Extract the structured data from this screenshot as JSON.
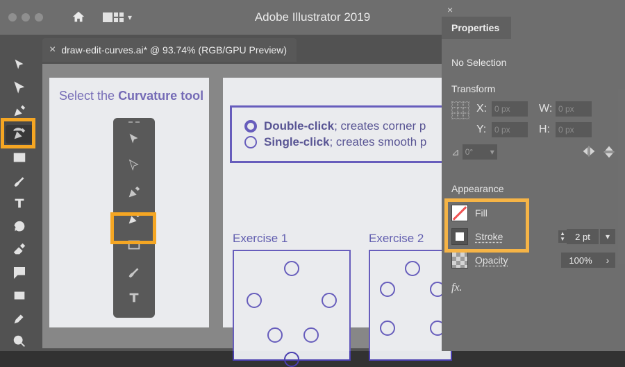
{
  "app": {
    "title": "Adobe Illustrator 2019"
  },
  "document": {
    "tab_label": "draw-edit-curves.ai* @ 93.74% (RGB/GPU Preview)"
  },
  "tutorial": {
    "heading_prefix": "Select the ",
    "heading_strong": "Curvature tool",
    "instructions": [
      {
        "strong": "Double-click",
        "rest": "; creates corner p"
      },
      {
        "strong": "Single-click",
        "rest": "; creates smooth p"
      }
    ],
    "ex1_label": "Exercise 1",
    "ex2_label": "Exercise 2"
  },
  "panel": {
    "title": "Properties",
    "selection": "No Selection",
    "transform_label": "Transform",
    "x_label": "X:",
    "y_label": "Y:",
    "w_label": "W:",
    "h_label": "H:",
    "x_val": "0 px",
    "y_val": "0 px",
    "w_val": "0 px",
    "h_val": "0 px",
    "angle_val": "0°",
    "appearance_label": "Appearance",
    "fill_label": "Fill",
    "stroke_label": "Stroke",
    "stroke_weight": "2 pt",
    "opacity_label": "Opacity",
    "opacity_value": "100%",
    "fx_label": "fx."
  }
}
